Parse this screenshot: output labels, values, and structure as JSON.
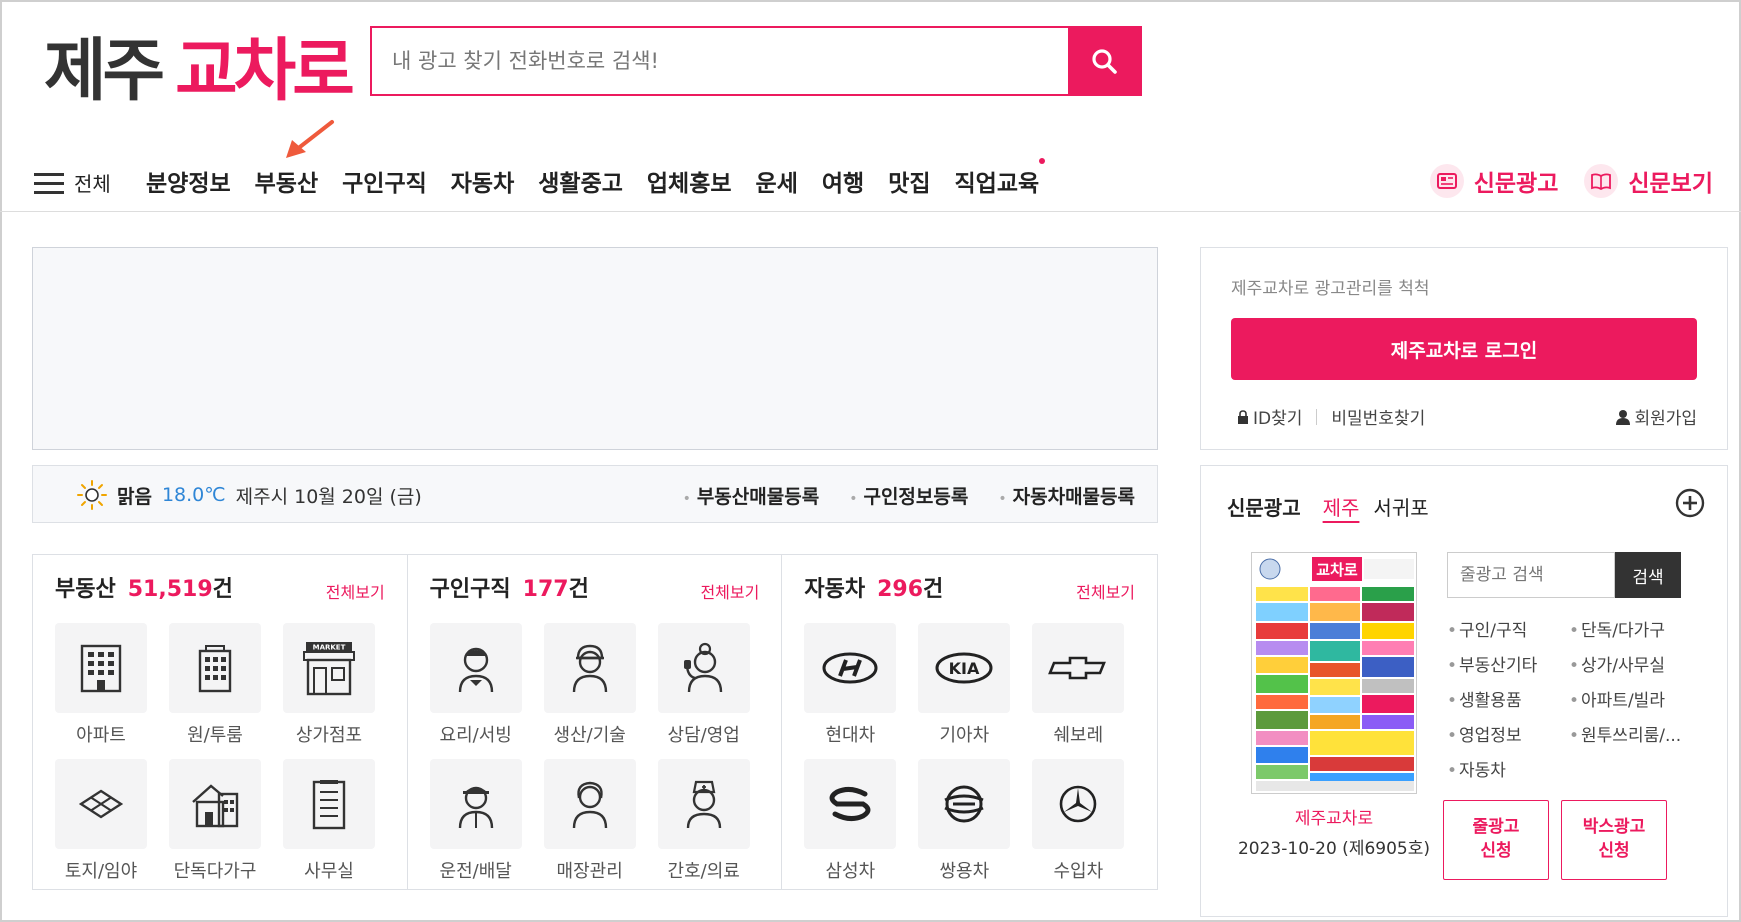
{
  "logo": {
    "part1": "제주",
    "part2": "교차로"
  },
  "search": {
    "placeholder": "내 광고 찾기 전화번호로 검색!"
  },
  "nav": {
    "all_label": "전체",
    "items": [
      "분양정보",
      "부동산",
      "구인구직",
      "자동차",
      "생활중고",
      "업체홍보",
      "운세",
      "여행",
      "맛집",
      "직업교육"
    ],
    "right": [
      "신문광고",
      "신문보기"
    ]
  },
  "weather": {
    "condition": "맑음",
    "temp": "18.0℃",
    "date": "제주시 10월 20일 (금)",
    "links": [
      "부동산매물등록",
      "구인정보등록",
      "자동차매물등록"
    ]
  },
  "categories": [
    {
      "title": "부동산",
      "count": "51,519",
      "unit": "건",
      "more": "전체보기",
      "items": [
        "아파트",
        "원/투룸",
        "상가점포",
        "토지/임야",
        "단독다가구",
        "사무실"
      ]
    },
    {
      "title": "구인구직",
      "count": "177",
      "unit": "건",
      "more": "전체보기",
      "items": [
        "요리/서빙",
        "생산/기술",
        "상담/영업",
        "운전/배달",
        "매장관리",
        "간호/의료"
      ]
    },
    {
      "title": "자동차",
      "count": "296",
      "unit": "건",
      "more": "전체보기",
      "items": [
        "현대차",
        "기아차",
        "쉐보레",
        "삼성차",
        "쌍용차",
        "수입차"
      ]
    }
  ],
  "login": {
    "tagline": "제주교차로 광고관리를 척척",
    "button": "제주교차로 로그인",
    "find_id": "ID찾기",
    "find_pw": "비밀번호찾기",
    "join": "회원가입"
  },
  "paper": {
    "title": "신문광고",
    "tab_active": "제주",
    "tab_other": "서귀포",
    "caption_name": "제주교차로",
    "caption_issue": "2023-10-20 (제6905호)",
    "search_placeholder": "줄광고 검색",
    "search_button": "검색",
    "list": [
      "구인/구직",
      "단독/다가구",
      "부동산기타",
      "상가/사무실",
      "생활용품",
      "아파트/빌라",
      "영업정보",
      "원투쓰리룸/...",
      "자동차"
    ],
    "apply_line": "줄광고\n신청",
    "apply_box": "박스광고\n신청",
    "thumb_title": "교차로"
  },
  "colors": {
    "accent": "#ec1a5e",
    "temp": "#2f86d6"
  }
}
